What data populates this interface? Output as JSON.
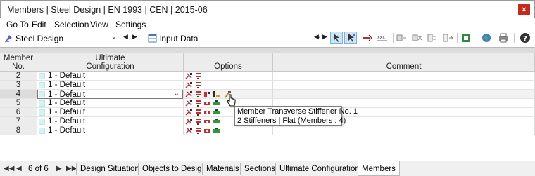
{
  "window": {
    "title": "Members | Steel Design | EN 1993 | CEN | 2015-06",
    "close_label": "×"
  },
  "menu": [
    "Go To",
    "Edit",
    "Selection",
    "View",
    "Settings"
  ],
  "toolbar": {
    "module_combo": "Steel Design",
    "table_combo": "Input Data"
  },
  "table": {
    "headers": {
      "member_no": "Member\nNo.",
      "member_no_l1": "Member",
      "member_no_l2": "No.",
      "ult_l1": "Ultimate",
      "ult_l2": "Configuration",
      "options": "Options",
      "comment": "Comment"
    },
    "rows": [
      {
        "no": "2",
        "config": "1 - Default"
      },
      {
        "no": "3",
        "config": "1 - Default"
      },
      {
        "no": "4",
        "config": "1 - Default"
      },
      {
        "no": "5",
        "config": "1 - Default"
      },
      {
        "no": "6",
        "config": "1 - Default"
      },
      {
        "no": "7",
        "config": "1 - Default"
      },
      {
        "no": "8",
        "config": "1 - Default"
      }
    ]
  },
  "tooltip": {
    "line1": "Member Transverse Stiffener No. 1",
    "line2": "2 Stiffeners | Flat (Members : 4)"
  },
  "tabs": {
    "count": "6 of 6",
    "items": [
      "Design Situations",
      "Objects to Design",
      "Materials",
      "Sections",
      "Ultimate Configurations",
      "Members"
    ],
    "active": "Members"
  },
  "colors": {
    "accent": "#c42b1c",
    "swatch": "#d8f2f4"
  }
}
